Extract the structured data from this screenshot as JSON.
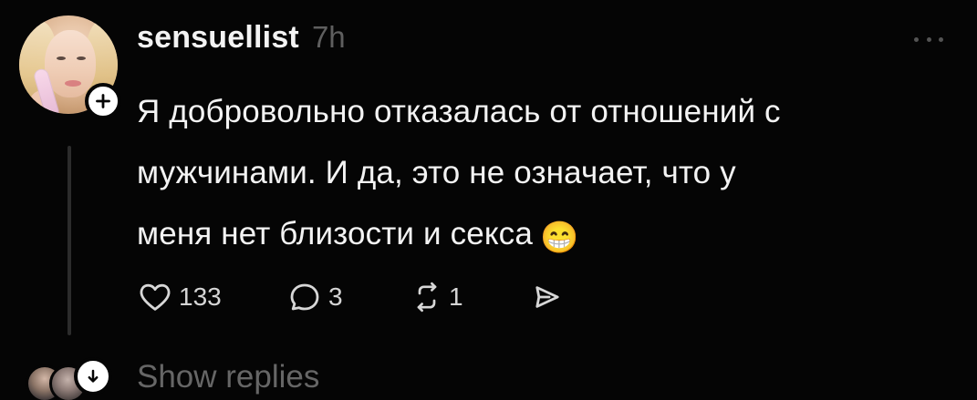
{
  "post": {
    "username": "sensuellist",
    "timestamp": "7h",
    "text": "Я добровольно отказалась от отношений с\nмужчинами. И да, это не означает, что у\nменя нет близости и секса",
    "emoji": "😁"
  },
  "actions": {
    "likes": "133",
    "replies": "3",
    "reposts": "1"
  },
  "footer": {
    "show_replies": "Show replies"
  },
  "icons": {
    "more": "more-horizontal-icon",
    "follow": "plus-icon",
    "like": "heart-icon",
    "reply": "comment-icon",
    "repost": "repost-icon",
    "share": "send-icon",
    "expand": "arrow-down-icon"
  },
  "colors": {
    "background": "#050505",
    "text": "#f3f3f3",
    "muted": "#5f5f5f",
    "action": "#d7d7d7",
    "thread_line": "#2c2c2c"
  }
}
